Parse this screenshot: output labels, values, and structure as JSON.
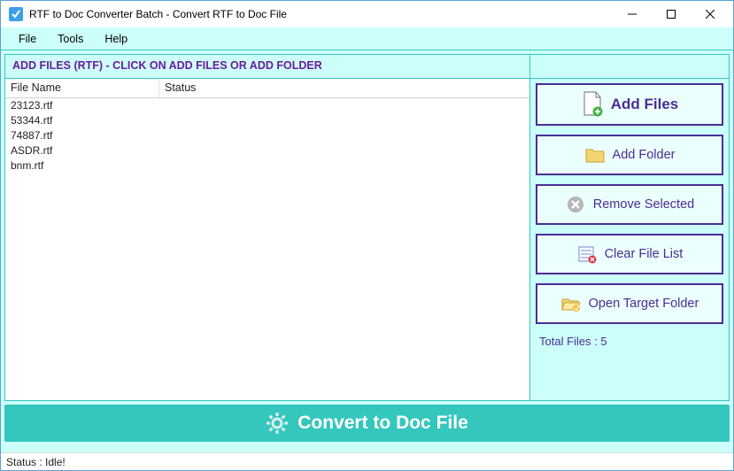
{
  "window": {
    "title": "RTF to Doc Converter Batch -  Convert RTF to Doc File"
  },
  "menu": {
    "file": "File",
    "tools": "Tools",
    "help": "Help"
  },
  "header": {
    "instruction": "ADD FILES (RTF) - CLICK ON ADD FILES OR ADD FOLDER"
  },
  "columns": {
    "filename": "File Name",
    "status": "Status"
  },
  "files": [
    {
      "name": "23123.rtf",
      "status": ""
    },
    {
      "name": "53344.rtf",
      "status": ""
    },
    {
      "name": "74887.rtf",
      "status": ""
    },
    {
      "name": "ASDR.rtf",
      "status": ""
    },
    {
      "name": "bnm.rtf",
      "status": ""
    }
  ],
  "buttons": {
    "add_files": "Add Files",
    "add_folder": "Add Folder",
    "remove_selected": "Remove Selected",
    "clear_list": "Clear File List",
    "open_target": "Open Target Folder"
  },
  "total_label": "Total Files : 5",
  "convert_label": "Convert to Doc File",
  "status": "Status  :  Idle!",
  "colors": {
    "accent": "#34c7bd",
    "purple": "#4b2d94",
    "panel": "#ccfffa"
  }
}
